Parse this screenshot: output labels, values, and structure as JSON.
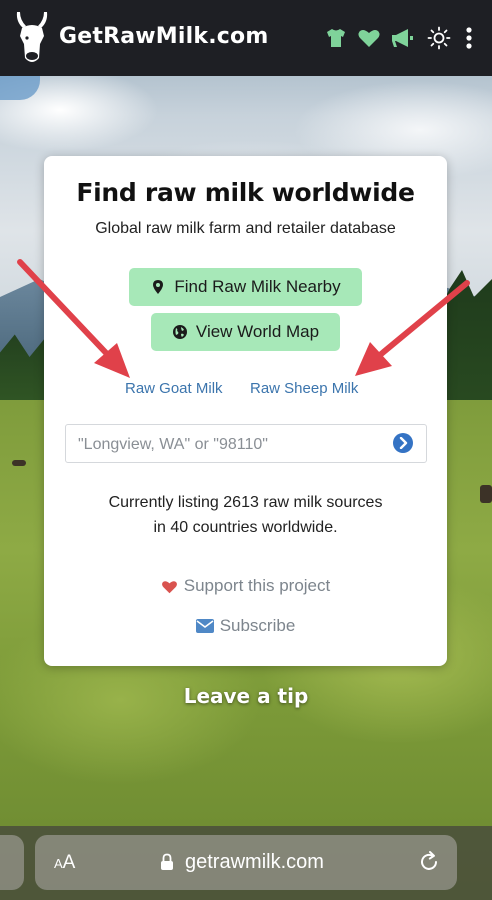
{
  "header": {
    "brand": "GetRawMilk.com",
    "icons": [
      "cow-logo-icon",
      "tshirt-icon",
      "heart-icon",
      "megaphone-icon",
      "sun-icon",
      "kebab-menu-icon"
    ],
    "accent_color": "#7fd39a",
    "background_color": "#1e1f24"
  },
  "card": {
    "title": "Find raw milk worldwide",
    "subtitle": "Global raw milk farm and retailer database",
    "buttons": {
      "nearby": "Find Raw Milk Nearby",
      "world_map": "View World Map"
    },
    "button_color": "#a7e8b8",
    "links": {
      "goat": "Raw Goat Milk",
      "sheep": "Raw Sheep Milk"
    },
    "search": {
      "placeholder": "\"Longview, WA\" or \"98110\"",
      "value": ""
    },
    "listing_line1": "Currently listing 2613 raw milk sources",
    "listing_line2": "in 40 countries worldwide.",
    "support": "Support this project",
    "subscribe": "Subscribe"
  },
  "tip": "Leave a tip",
  "browser": {
    "text_size_label_small": "A",
    "text_size_label_large": "A",
    "url": "getrawmilk.com"
  },
  "annotation_color": "#e0414a"
}
